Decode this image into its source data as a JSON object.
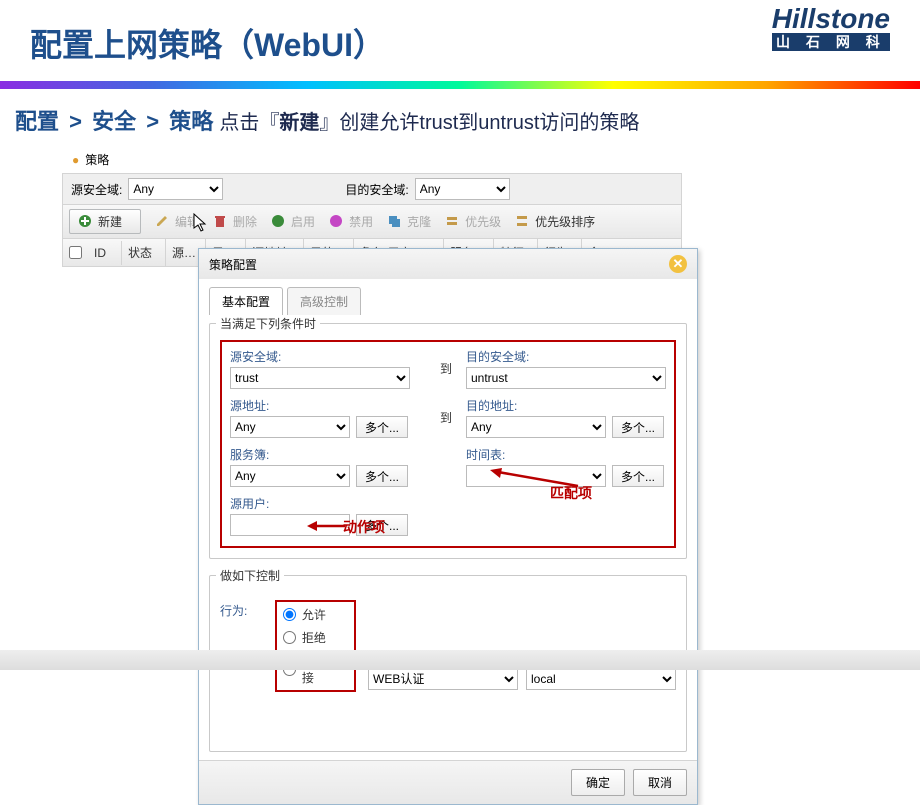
{
  "slide": {
    "title": "配置上网策略（WebUI）"
  },
  "brand": {
    "name": "Hillstone",
    "cn": "山 石 网 科"
  },
  "breadcrumb": {
    "a": "配置",
    "b": "安全",
    "c": "策略",
    "sep": ">",
    "instruction_pre": "点击『",
    "instruction_btn": "新建",
    "instruction_post": "』创建允许trust到untrust访问的策略"
  },
  "app": {
    "policy_label": "策略",
    "zonebar": {
      "src_label": "源安全域:",
      "src_value": "Any",
      "dst_label": "目的安全域:",
      "dst_value": "Any"
    },
    "toolbar": {
      "new": "新建",
      "edit": "编辑",
      "delete": "删除",
      "enable": "启用",
      "disable": "禁用",
      "clone": "克隆",
      "priority": "优先级",
      "priority_sort": "优先级排序"
    },
    "columns": {
      "id": "ID",
      "status": "状态",
      "src": "源…",
      "dst": "目…",
      "src_addr": "源地址",
      "dst_addr": "目的…",
      "role_user": "角色/用户/…",
      "service": "服务",
      "feature": "特征",
      "action": "行为",
      "cmd": "命…"
    }
  },
  "dialog": {
    "title": "策略配置",
    "tabs": {
      "basic": "基本配置",
      "advanced": "高级控制"
    },
    "fieldset1_legend": "当满足下列条件时",
    "labels": {
      "src_zone": "源安全域:",
      "dst_zone": "目的安全域:",
      "src_addr": "源地址:",
      "dst_addr": "目的地址:",
      "service": "服务簿:",
      "schedule": "时间表:",
      "src_user": "源用户:",
      "to": "到",
      "more": "多个..."
    },
    "values": {
      "src_zone": "trust",
      "dst_zone": "untrust",
      "src_addr": "Any",
      "dst_addr": "Any",
      "service": "Any",
      "schedule": "",
      "src_user": ""
    },
    "fieldset2_legend": "做如下控制",
    "action_label": "行为:",
    "actions": {
      "permit": "允许",
      "deny": "拒绝",
      "secure": "安全连接",
      "webauth": "WEB认证",
      "local": "local"
    },
    "buttons": {
      "ok": "确定",
      "cancel": "取消"
    }
  },
  "annotations": {
    "match": "匹配项",
    "action": "动作项"
  }
}
